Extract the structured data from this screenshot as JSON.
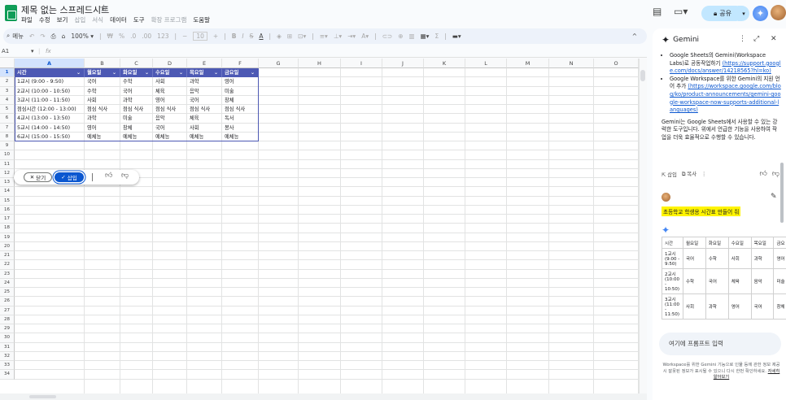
{
  "header": {
    "title": "제목 없는 스프레드시트",
    "menus": [
      "파일",
      "수정",
      "보기",
      "삽입",
      "서식",
      "데이터",
      "도구",
      "확장 프로그램",
      "도움말"
    ],
    "share_label": "공유"
  },
  "toolbar": {
    "search_label": "메뉴",
    "zoom": "100%",
    "currency": "₩",
    "percent": "%",
    "dec_less": ".0",
    "dec_more": ".00",
    "format_123": "123",
    "font_minus": "−",
    "font_size": "10",
    "font_plus": "+",
    "bold": "B",
    "italic": "I",
    "strike": "S",
    "text_color": "A",
    "caret_up": "^"
  },
  "formula_bar": {
    "cell_ref": "A1",
    "fx": "fx"
  },
  "grid": {
    "columns": [
      "A",
      "B",
      "C",
      "D",
      "E",
      "F",
      "G",
      "H",
      "I",
      "J",
      "K",
      "L",
      "M",
      "N",
      "O"
    ],
    "row_count": 34,
    "table_header": [
      "시간",
      "월요일",
      "화요일",
      "수요일",
      "목요일",
      "금요일"
    ],
    "table_rows": [
      [
        "1교시 (9:00 - 9:50)",
        "국어",
        "수학",
        "사회",
        "과학",
        "영어"
      ],
      [
        "2교시 (10:00 - 10:50)",
        "수학",
        "국어",
        "체육",
        "음악",
        "미술"
      ],
      [
        "3교시 (11:00 - 11:50)",
        "사회",
        "과학",
        "영어",
        "국어",
        "창체"
      ],
      [
        "점심시간 (12:00 - 13:00)",
        "점심 식사",
        "점심 식사",
        "점심 식사",
        "점심 식사",
        "점심 식사"
      ],
      [
        "4교시 (13:00 - 13:50)",
        "과학",
        "미술",
        "음악",
        "체육",
        "독서"
      ],
      [
        "5교시 (14:00 - 14:50)",
        "영어",
        "창체",
        "국어",
        "사회",
        "봉사"
      ],
      [
        "6교시 (15:00 - 15:50)",
        "예체능",
        "예체능",
        "예체능",
        "예체능",
        "예체능"
      ]
    ],
    "header_color": "#4d59b4"
  },
  "action_bar": {
    "close_label": "닫기",
    "insert_label": "삽입"
  },
  "gemini": {
    "title": "Gemini",
    "bullets": [
      {
        "text": "Google Sheets의 Gemini(Workspace Labs)로 공동작업하기",
        "link": "(https://support.google.com/docs/answer/14218565?hl=ko)"
      },
      {
        "text": "Google Workspace를 위한 Gemini의 지원 언어 추가",
        "link": "(https://workspace.google.com/blog/ko/product-announcements/gemini-google-workspace-now-supports-additional-languages)"
      }
    ],
    "paragraph": "Gemini는 Google Sheets에서 사용할 수 있는 강력한 도구입니다. 위에서 언급한 기능을 사용하여 작업을 더욱 효율적으로 수행할 수 있습니다.",
    "insert_label": "삽입",
    "copy_label": "복사",
    "user_prompt": "초등학교 학생용 시간표 만들어 줘",
    "preview_table": [
      [
        "시간",
        "월요일",
        "화요일",
        "수요일",
        "목요일",
        "금요"
      ],
      [
        "1교시 (9:00 - 9:50)",
        "국어",
        "수학",
        "사회",
        "과학",
        "영어"
      ],
      [
        "2교시 (10:00 - 10:50)",
        "수학",
        "국어",
        "체육",
        "음악",
        "미술"
      ],
      [
        "3교시 (11:00 - 11:50)",
        "사회",
        "과학",
        "영어",
        "국어",
        "창체"
      ]
    ],
    "input_placeholder": "여기에 프롬프트 입력",
    "footer_text": "Workspace를 위한 Gemini 기능으로 인물 등에 관한 정보 제공 시 잘못된 정보가 표시될 수 있으니 다시 한번 확인하세요.",
    "footer_link": "자세히 알아보기"
  }
}
